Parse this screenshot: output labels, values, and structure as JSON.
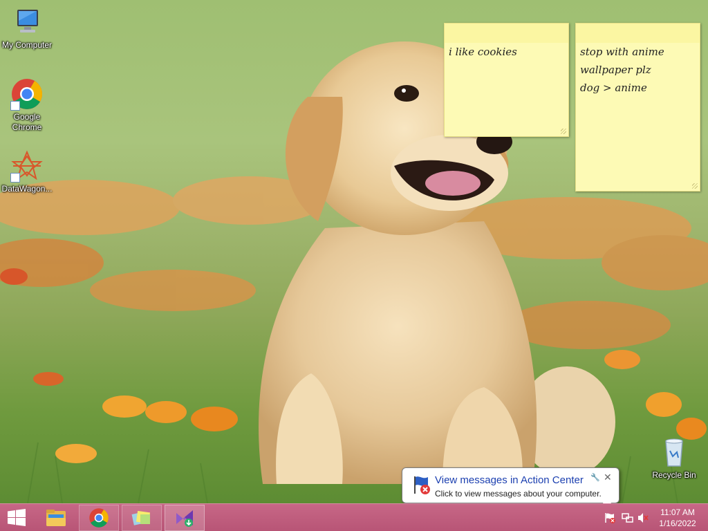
{
  "desktop": {
    "icons": [
      {
        "label": "My Computer",
        "icon": "computer-icon"
      },
      {
        "label": "Google",
        "label2": "Chrome",
        "icon": "chrome-icon"
      },
      {
        "label": "DataWagon...",
        "icon": "datawagon-icon"
      }
    ],
    "recycle_bin": {
      "label": "Recycle Bin",
      "icon": "recycle-bin-icon"
    }
  },
  "sticky_notes": [
    {
      "lines": [
        "i like cookies"
      ]
    },
    {
      "lines": [
        "stop with anime",
        "wallpaper plz",
        "dog > anime"
      ]
    }
  ],
  "notification": {
    "title": "View messages in Action Center",
    "body": "Click to view messages about your computer.",
    "icon": "action-center-flag-icon"
  },
  "taskbar": {
    "apps": [
      {
        "name": "file-explorer",
        "icon": "folder-icon"
      },
      {
        "name": "google-chrome",
        "icon": "chrome-icon"
      },
      {
        "name": "sticky-notes",
        "icon": "sticky-notes-icon"
      },
      {
        "name": "visual-studio-installer",
        "icon": "visual-studio-icon"
      }
    ],
    "tray": {
      "icons": [
        "action-center-icon",
        "network-icon",
        "volume-muted-icon"
      ],
      "time": "11:07 AM",
      "date": "1/16/2022"
    }
  },
  "colors": {
    "taskbar": "#b85576",
    "sticky": "#fdfab5",
    "link_blue": "#1b3fb0"
  }
}
